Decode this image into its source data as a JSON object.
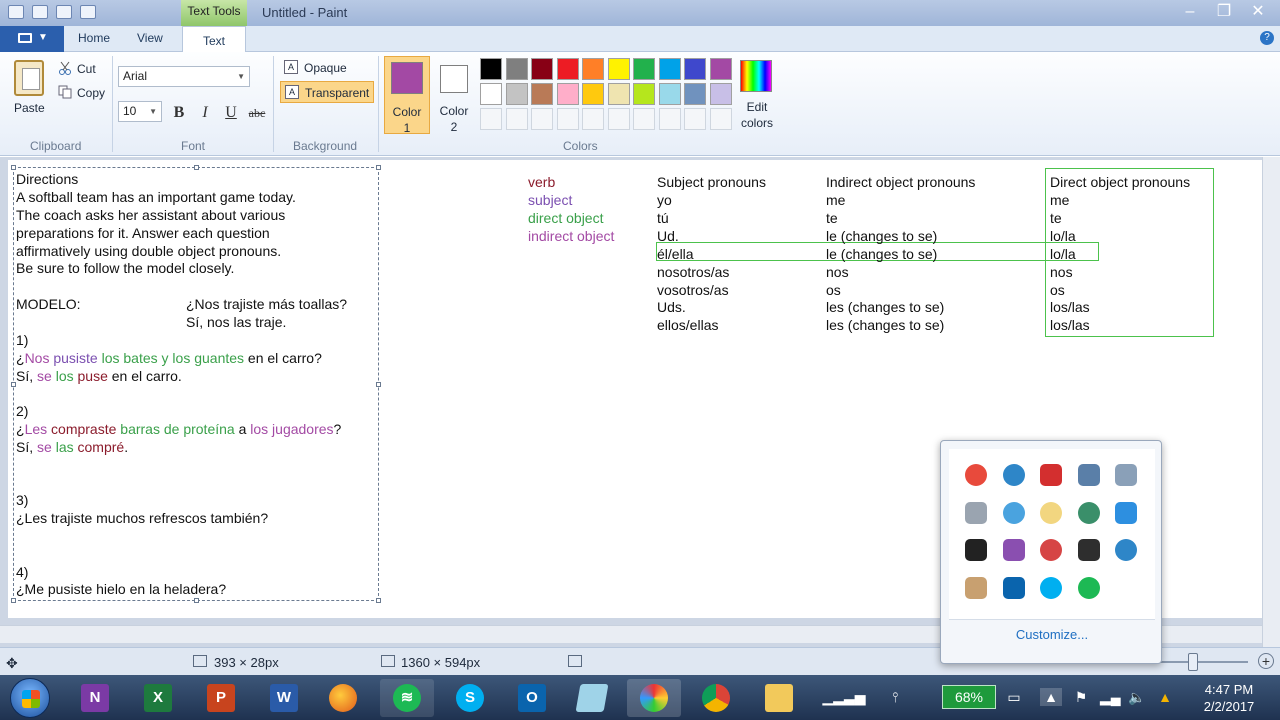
{
  "window": {
    "title": "Untitled - Paint",
    "context_tab": "Text Tools"
  },
  "ribbon": {
    "tabs": [
      "Home",
      "View",
      "Text"
    ],
    "active_tab": "Text",
    "clipboard": {
      "paste": "Paste",
      "cut": "Cut",
      "copy": "Copy",
      "label": "Clipboard"
    },
    "font": {
      "family": "Arial",
      "size": "10",
      "bold": "B",
      "italic": "I",
      "underline": "U",
      "strike": "abc",
      "label": "Font"
    },
    "background": {
      "opaque": "Opaque",
      "transparent": "Transparent",
      "label": "Background"
    },
    "colors": {
      "color1_label": "Color 1",
      "color1_line1": "Color",
      "color1_line2": "1",
      "color2_line1": "Color",
      "color2_line2": "2",
      "edit_line1": "Edit",
      "edit_line2": "colors",
      "label": "Colors",
      "color1": "#a349a4",
      "color2": "#ffffff",
      "palette_row1": [
        "#000000",
        "#7f7f7f",
        "#880015",
        "#ed1c24",
        "#ff7f27",
        "#fff200",
        "#22b14c",
        "#00a2e8",
        "#3f48cc",
        "#a349a4"
      ],
      "palette_row2": [
        "#ffffff",
        "#c3c3c3",
        "#b97a57",
        "#ffaec9",
        "#ffc90e",
        "#efe4b0",
        "#b5e61d",
        "#99d9ea",
        "#7092be",
        "#c8bfe7"
      ]
    }
  },
  "canvas": {
    "directions": [
      "Directions",
      "A softball team has an important game today.",
      "The coach asks her assistant about various",
      "preparations for it. Answer each question",
      "affirmatively using double object pronouns.",
      "Be sure to follow the model closely."
    ],
    "modelo": {
      "label": "MODELO:",
      "q": "¿Nos trajiste más toallas?",
      "a": "Sí, nos las traje."
    },
    "items": {
      "n1": "1)",
      "q1": {
        "a": "¿",
        "b": "Nos",
        "c": " ",
        "d": "pusiste",
        "e": " ",
        "f": "los bates y los guantes",
        "g": " en el carro?"
      },
      "a1": {
        "a": "Sí, ",
        "b": "se",
        "c": " ",
        "d": "los",
        "e": " ",
        "f": "puse",
        "g": " en el carro."
      },
      "n2": "2)",
      "q2": {
        "a": "¿",
        "b": "Les",
        "c": " ",
        "d": "compraste",
        "e": " ",
        "f": "barras de proteína",
        "g": " a ",
        "h": "los jugadores",
        "i": "?"
      },
      "a2": {
        "a": "Sí, ",
        "b": "se",
        "c": " ",
        "d": "las",
        "e": " ",
        "f": "compré",
        "g": "."
      },
      "n3": "3)",
      "q3": "¿Les trajiste muchos refrescos también?",
      "n4": "4)",
      "q4": "¿Me pusiste hielo en la heladera?"
    },
    "legend": [
      "verb",
      "subject",
      "direct object",
      "indirect object"
    ],
    "legend_colors": {
      "verb": "#8b1c2c",
      "subject": "#7b4fb0",
      "direct_object": "#3aa04a",
      "indirect_object": "#a34aa4"
    },
    "table": {
      "headers": [
        "Subject pronouns",
        "Indirect object pronouns",
        "Direct object pronouns"
      ],
      "rows": [
        [
          "yo",
          "me",
          "me"
        ],
        [
          "tú",
          "te",
          "te"
        ],
        [
          "Ud.",
          "le (changes to se)",
          "lo/la"
        ],
        [
          "él/ella",
          "le (changes to se)",
          "lo/la"
        ],
        [
          "nosotros/as",
          "nos",
          "nos"
        ],
        [
          "vosotros/as",
          "os",
          "os"
        ],
        [
          "Uds.",
          "les (changes to se)",
          "los/las"
        ],
        [
          "ellos/ellas",
          "les (changes to se)",
          "los/las"
        ]
      ]
    }
  },
  "status": {
    "selection_size": "393 × 28px",
    "canvas_size": "1360 × 594px"
  },
  "tray_popup": {
    "customize": "Customize...",
    "icons": [
      "app-icon",
      "globe-icon",
      "red-app-icon",
      "notes-icon",
      "screen-icon",
      "clipboard-icon",
      "onedrive-icon",
      "weather-icon",
      "network-globe-icon",
      "teamviewer-icon",
      "flag-f-icon",
      "onenote-icon",
      "chat-icon",
      "nvidia-icon",
      "tool-icon",
      "hand-icon",
      "outlook-icon",
      "skype-icon",
      "spotify-icon"
    ]
  },
  "taskbar": {
    "apps": [
      "onenote",
      "excel",
      "powerpoint",
      "word",
      "firefox",
      "spotify",
      "skype",
      "outlook",
      "notepad",
      "paint",
      "chrome",
      "explorer"
    ],
    "battery": "68%",
    "time": "4:47 PM",
    "date": "2/2/2017"
  }
}
